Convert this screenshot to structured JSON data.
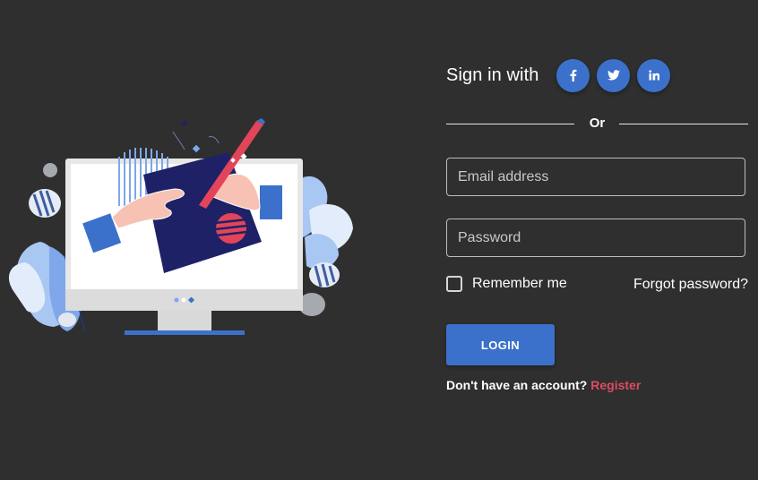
{
  "login": {
    "signin_title": "Sign in with",
    "social": [
      {
        "name": "facebook",
        "icon": "facebook-icon"
      },
      {
        "name": "twitter",
        "icon": "twitter-icon"
      },
      {
        "name": "linkedin",
        "icon": "linkedin-icon"
      }
    ],
    "divider_text": "Or",
    "email_placeholder": "Email address",
    "password_placeholder": "Password",
    "remember_label": "Remember me",
    "forgot_label": "Forgot password?",
    "login_button": "LOGIN",
    "register_prompt": "Don't have an account?",
    "register_link": "Register"
  },
  "illustration": {
    "icon": "computer-drawing-illustration"
  },
  "colors": {
    "background": "#2f2f2f",
    "primary": "#3b71ca",
    "danger": "#dc4c64",
    "text": "#ffffff"
  }
}
